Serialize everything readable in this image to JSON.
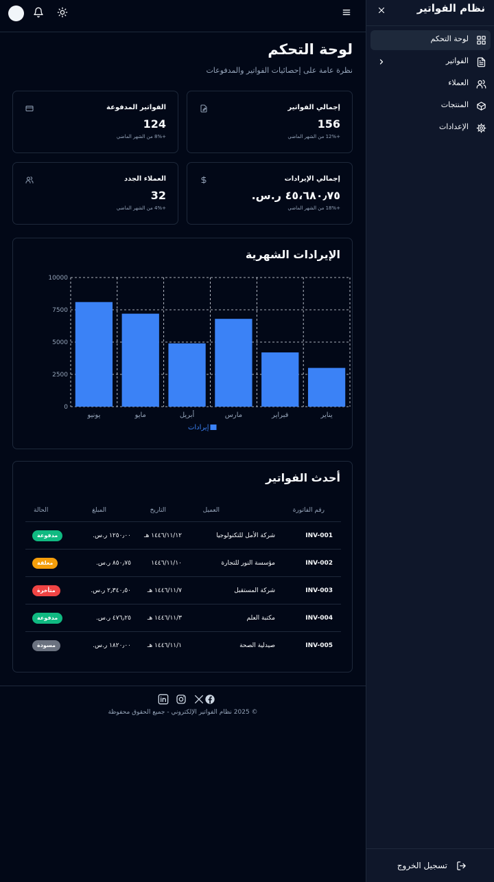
{
  "sidebar": {
    "title": "نظام الفواتير",
    "items": [
      {
        "label": "لوحة التحكم",
        "icon": "dashboard-icon",
        "active": true
      },
      {
        "label": "الفواتير",
        "icon": "file-text-icon",
        "has_submenu": true
      },
      {
        "label": "العملاء",
        "icon": "users-icon"
      },
      {
        "label": "المنتجات",
        "icon": "package-icon"
      },
      {
        "label": "الإعدادات",
        "icon": "settings-icon"
      }
    ],
    "logout_label": "تسجيل الخروج"
  },
  "header": {
    "icons": [
      "avatar",
      "bell-icon",
      "sun-icon",
      "menu-icon"
    ]
  },
  "page": {
    "title": "لوحة التحكم",
    "subtitle": "نظرة عامة على إحصائيات الفواتير والمدفوعات"
  },
  "stats": [
    {
      "title": "إجمالي الفواتير",
      "value": "156",
      "change": "+12% من الشهر الماضي",
      "icon": "edit-file-icon"
    },
    {
      "title": "الفواتير المدفوعة",
      "value": "124",
      "change": "+8% من الشهر الماضي",
      "icon": "credit-card-icon"
    },
    {
      "title": "إجمالي الإيرادات",
      "value": "٤٥،٦٨٠٫٧٥ ر.س.",
      "change": "+18% من الشهر الماضي",
      "icon": "dollar-icon"
    },
    {
      "title": "العملاء الجدد",
      "value": "32",
      "change": "+4% من الشهر الماضي",
      "icon": "users-icon"
    }
  ],
  "chart_section": {
    "title": "الإيرادات الشهرية"
  },
  "chart_data": {
    "type": "bar",
    "categories": [
      "يناير",
      "فبراير",
      "مارس",
      "أبريل",
      "مايو",
      "يونيو"
    ],
    "series": [
      {
        "name": "إيرادات",
        "values": [
          3000,
          4200,
          6800,
          4900,
          7200,
          8100
        ],
        "color": "#3b82f6"
      }
    ],
    "y_ticks": [
      "0",
      "2500",
      "5000",
      "7500",
      "10000"
    ],
    "ylim": [
      0,
      10000
    ],
    "grid": true,
    "grid_style": "dashed",
    "legend_position": "bottom",
    "x_axis_direction": "right-to-left"
  },
  "invoices": {
    "title": "أحدث الفواتير",
    "columns": [
      "رقم الفاتورة",
      "العميل",
      "التاريخ",
      "المبلغ",
      "الحالة"
    ],
    "rows": [
      {
        "number": "INV-001",
        "client": "شركة الأمل للتكنولوجيا",
        "date": "١٤٤٦/١١/١٢ هـ",
        "amount": "١٢٥٠٫٠٠ ر.س.",
        "status": "مدفوعة",
        "status_color": "#10b981"
      },
      {
        "number": "INV-002",
        "client": "مؤسسة النور للتجارة",
        "date": "١٤٤٦/١١/١٠",
        "amount": "٨٥٠٫٧٥ ر.س.",
        "status": "معلقة",
        "status_color": "#f59e0b"
      },
      {
        "number": "INV-003",
        "client": "شركة المستقبل",
        "date": "١٤٤٦/١١/٧ هـ",
        "amount": "٢٫٣٤٠٫٥٠ ر.س.",
        "status": "متأخرة",
        "status_color": "#ef4444"
      },
      {
        "number": "INV-004",
        "client": "مكتبة العلم",
        "date": "١٤٤٦/١١/٣ هـ",
        "amount": "٤٧٦٫٢٥ ر.س.",
        "status": "مدفوعة",
        "status_color": "#10b981"
      },
      {
        "number": "INV-005",
        "client": "صيدلية الصحة",
        "date": "١٤٤٦/١١/١ هـ",
        "amount": "١٨٢٠٫٠٠ ر.س.",
        "status": "مسودة",
        "status_color": "#6b7280"
      }
    ]
  },
  "footer": {
    "social": [
      "linkedin-icon",
      "instagram-icon",
      "x-icon",
      "facebook-icon"
    ],
    "copyright": "© 2025 نظام الفواتير الإلكتروني - جميع الحقوق محفوظة"
  }
}
